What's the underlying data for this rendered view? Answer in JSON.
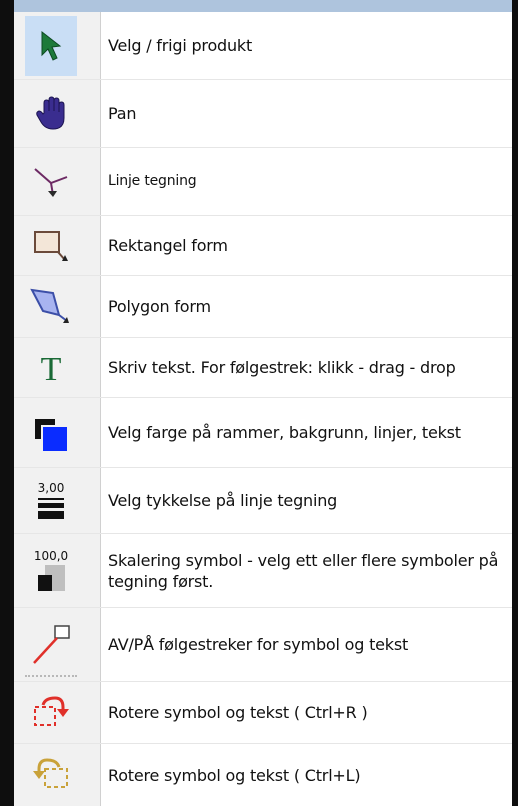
{
  "items": [
    {
      "label": "Velg / frigi produkt",
      "icon": "select-arrow-icon"
    },
    {
      "label": "Pan",
      "icon": "hand-icon"
    },
    {
      "label": "Linje tegning",
      "icon": "line-draw-icon"
    },
    {
      "label": "Rektangel form",
      "icon": "rectangle-icon"
    },
    {
      "label": "Polygon form",
      "icon": "polygon-icon"
    },
    {
      "label": "Skriv tekst. For følgestrek: klikk - drag - drop",
      "icon": "text-icon"
    },
    {
      "label": "Velg farge på rammer, bakgrunn, linjer, tekst",
      "icon": "color-icon"
    },
    {
      "label": "Velg tykkelse på linje tegning",
      "icon": "line-thickness-icon",
      "icon_value": "3,00"
    },
    {
      "label": "Skalering symbol - velg ett eller flere symboler på tegning først.",
      "icon": "scale-icon",
      "icon_value": "100,0"
    },
    {
      "label": "AV/PÅ følgestreker for symbol og tekst",
      "icon": "leader-line-icon"
    },
    {
      "label": "Rotere symbol og tekst ( Ctrl+R )",
      "icon": "rotate-right-icon"
    },
    {
      "label": "Rotere symbol og tekst ( Ctrl+L)",
      "icon": "rotate-left-icon"
    }
  ],
  "colors": {
    "selected": "#c9def5",
    "arrow": "#1d7a3a",
    "hand": "#3a2d8f",
    "blue": "#0a2cff",
    "red": "#e0302a"
  }
}
